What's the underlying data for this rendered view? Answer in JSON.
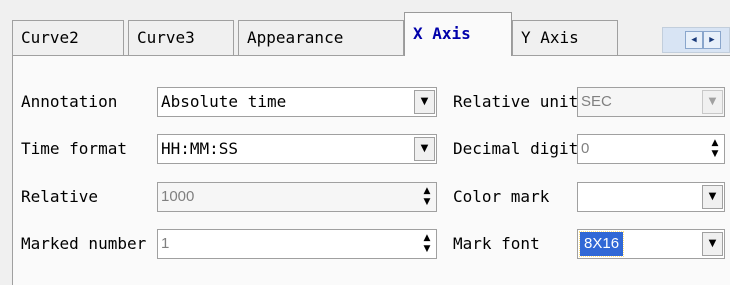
{
  "tabs": [
    {
      "label": "Curve2"
    },
    {
      "label": "Curve3"
    },
    {
      "label": "Appearance"
    },
    {
      "label": "X Axis"
    },
    {
      "label": "Y Axis"
    }
  ],
  "active_tab": "X Axis",
  "form": {
    "annotation": {
      "label": "Annotation",
      "value": "Absolute time"
    },
    "time_format": {
      "label": "Time format",
      "value": "HH:MM:SS"
    },
    "relative": {
      "label": "Relative",
      "value": "1000"
    },
    "marked_number": {
      "label": "Marked number",
      "value": "1"
    },
    "relative_unit": {
      "label": "Relative unit",
      "value": "SEC"
    },
    "decimal_digits": {
      "label": "Decimal digits",
      "value": "0"
    },
    "color_mark": {
      "label": "Color mark",
      "value": ""
    },
    "mark_font": {
      "label": "Mark font",
      "value": "8X16"
    }
  },
  "icons": {
    "dropdown": "▼",
    "spin_up": "▲",
    "spin_down": "▼",
    "scroll_left": "◀",
    "scroll_right": "▶"
  },
  "colors": {
    "active_tab_text": "#0000aa",
    "selection": "#3168d6"
  }
}
